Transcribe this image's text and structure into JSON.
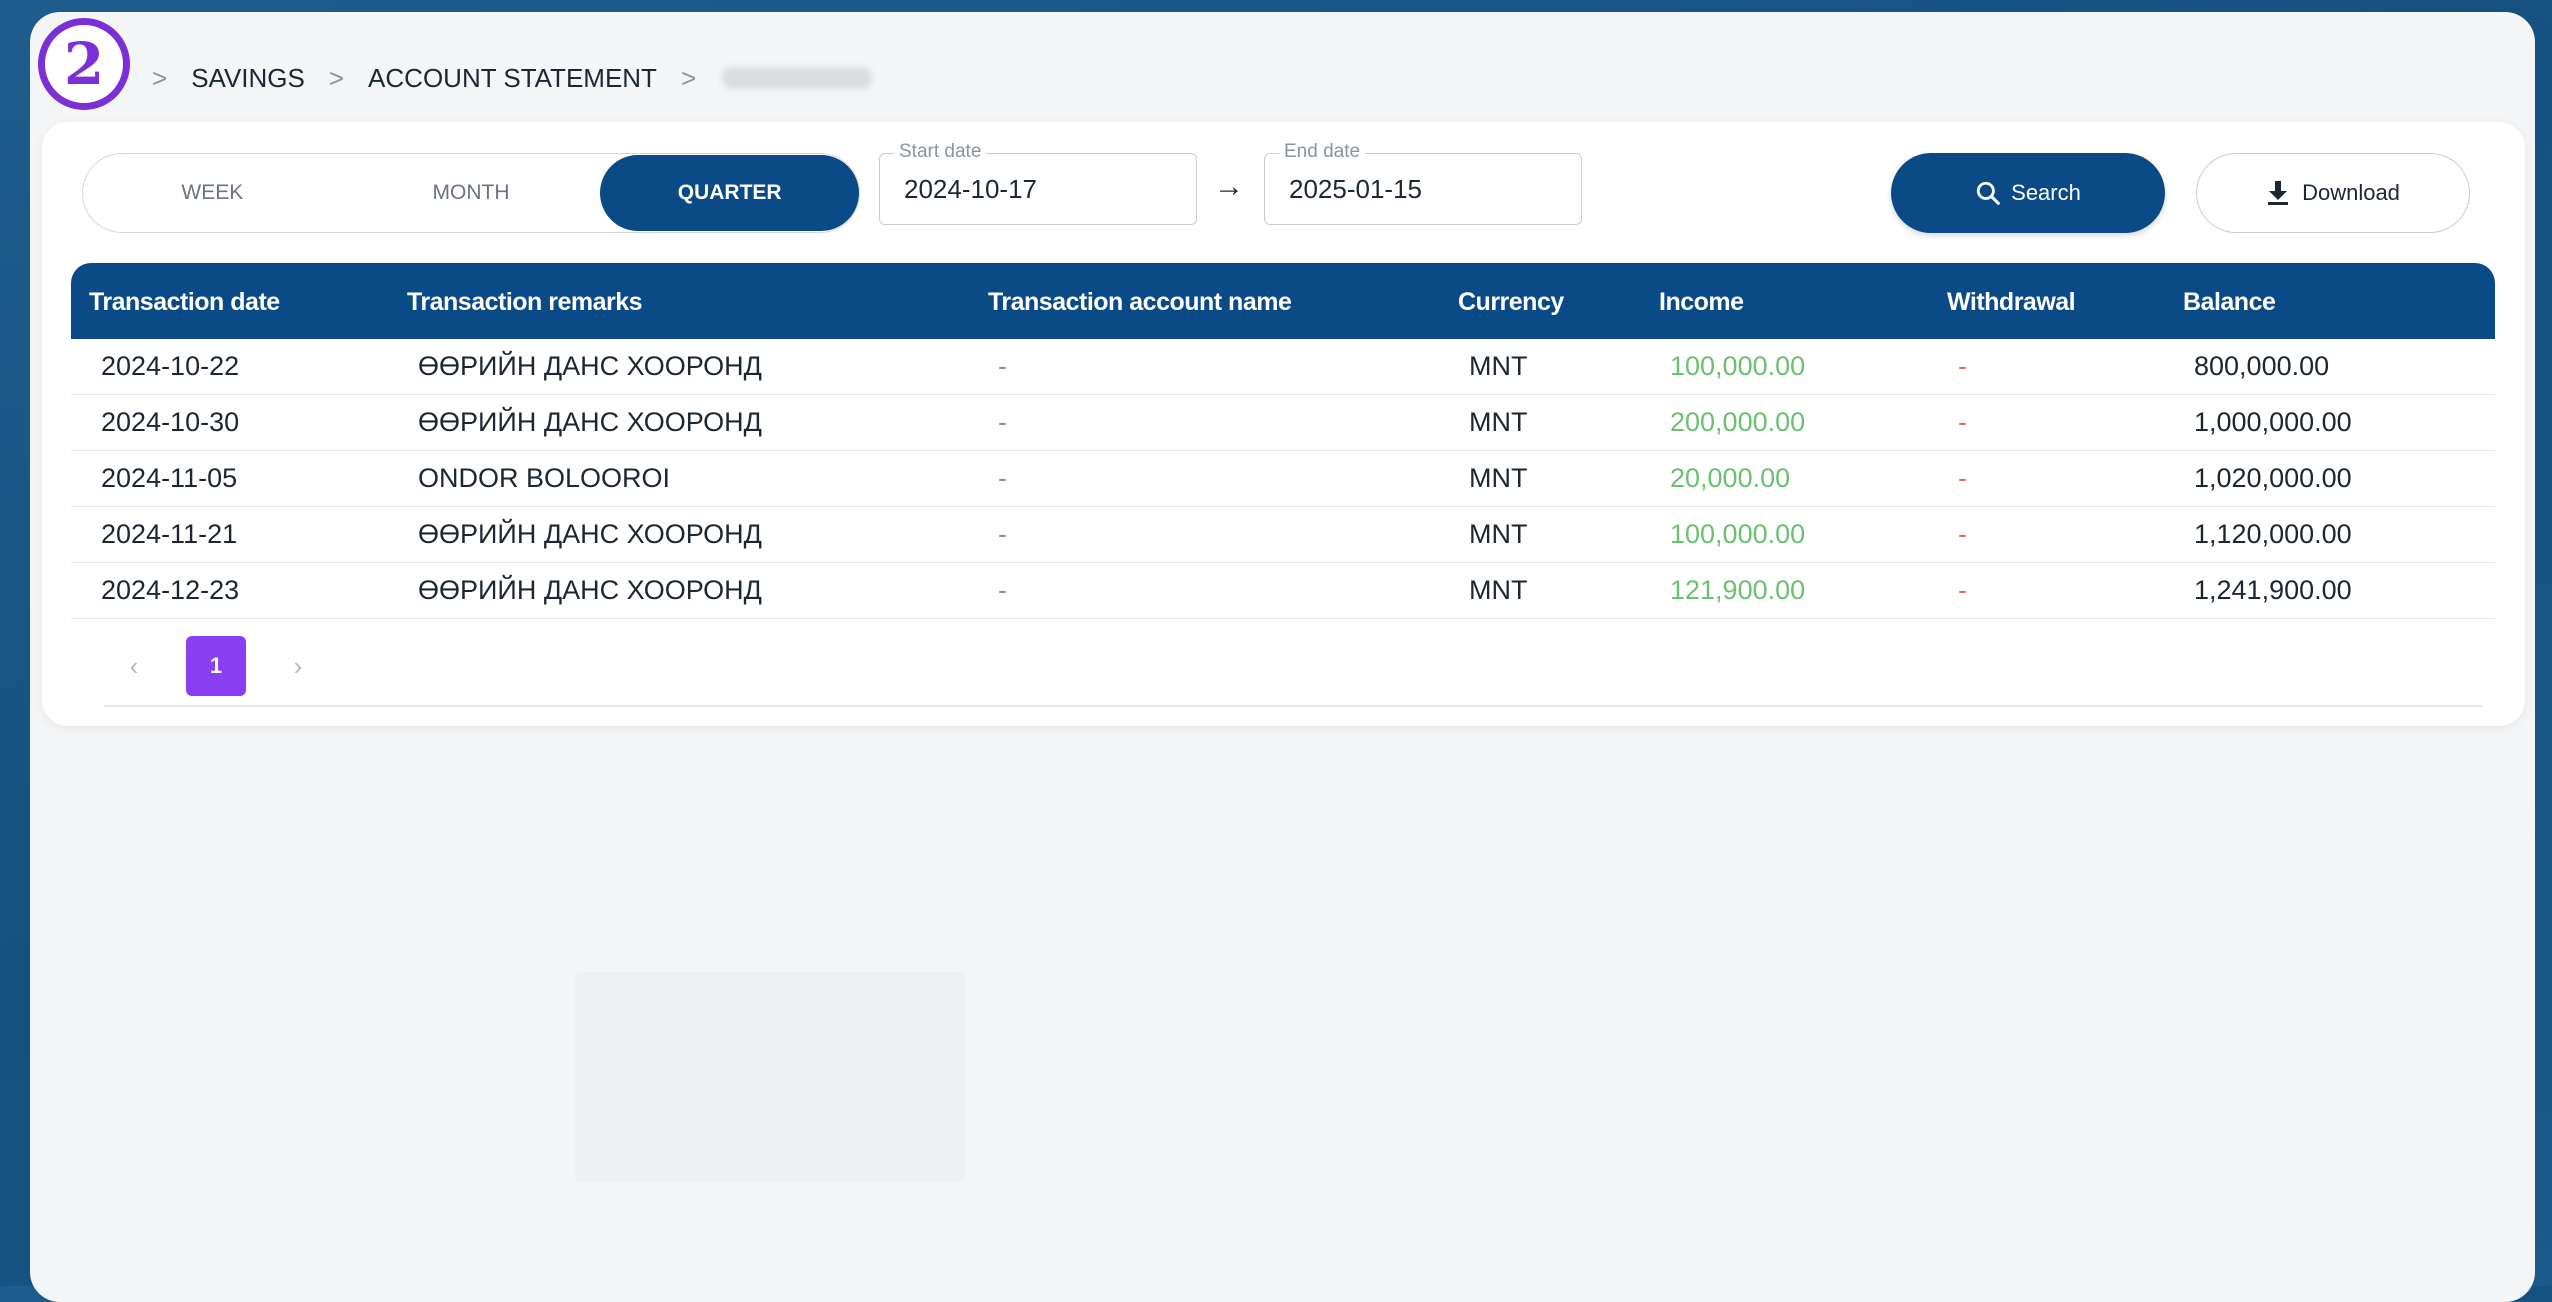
{
  "step_badge": "2",
  "breadcrumb": {
    "items": [
      "SAVINGS",
      "ACCOUNT STATEMENT"
    ]
  },
  "period": {
    "options": [
      "WEEK",
      "MONTH",
      "QUARTER"
    ],
    "selected": "QUARTER"
  },
  "dates": {
    "start_label": "Start date",
    "start_value": "2024-10-17",
    "end_label": "End date",
    "end_value": "2025-01-15",
    "arrow": "→"
  },
  "buttons": {
    "search": "Search",
    "download": "Download"
  },
  "table": {
    "headers": [
      "Transaction date",
      "Transaction remarks",
      "Transaction account name",
      "Currency",
      "Income",
      "Withdrawal",
      "Balance"
    ],
    "rows": [
      [
        "2024-10-22",
        "ӨӨРИЙН ДАНС ХООРОНД",
        "-",
        "MNT",
        "100,000.00",
        "-",
        "800,000.00"
      ],
      [
        "2024-10-30",
        "ӨӨРИЙН ДАНС ХООРОНД",
        "-",
        "MNT",
        "200,000.00",
        "-",
        "1,000,000.00"
      ],
      [
        "2024-11-05",
        "ONDOR BOLOOROI",
        "-",
        "MNT",
        "20,000.00",
        "-",
        "1,020,000.00"
      ],
      [
        "2024-11-21",
        "ӨӨРИЙН ДАНС ХООРОНД",
        "-",
        "MNT",
        "100,000.00",
        "-",
        "1,120,000.00"
      ],
      [
        "2024-12-23",
        "ӨӨРИЙН ДАНС ХООРОНД",
        "-",
        "MNT",
        "121,900.00",
        "-",
        "1,241,900.00"
      ]
    ]
  },
  "pagination": {
    "prev": "‹",
    "current": "1",
    "next": "›"
  },
  "colors": {
    "primary": "#0a4a86",
    "income": "#6bc16f",
    "withdrawal": "#e06b6b",
    "page_active": "#8a3ff2",
    "badge": "#7b2fd6"
  }
}
